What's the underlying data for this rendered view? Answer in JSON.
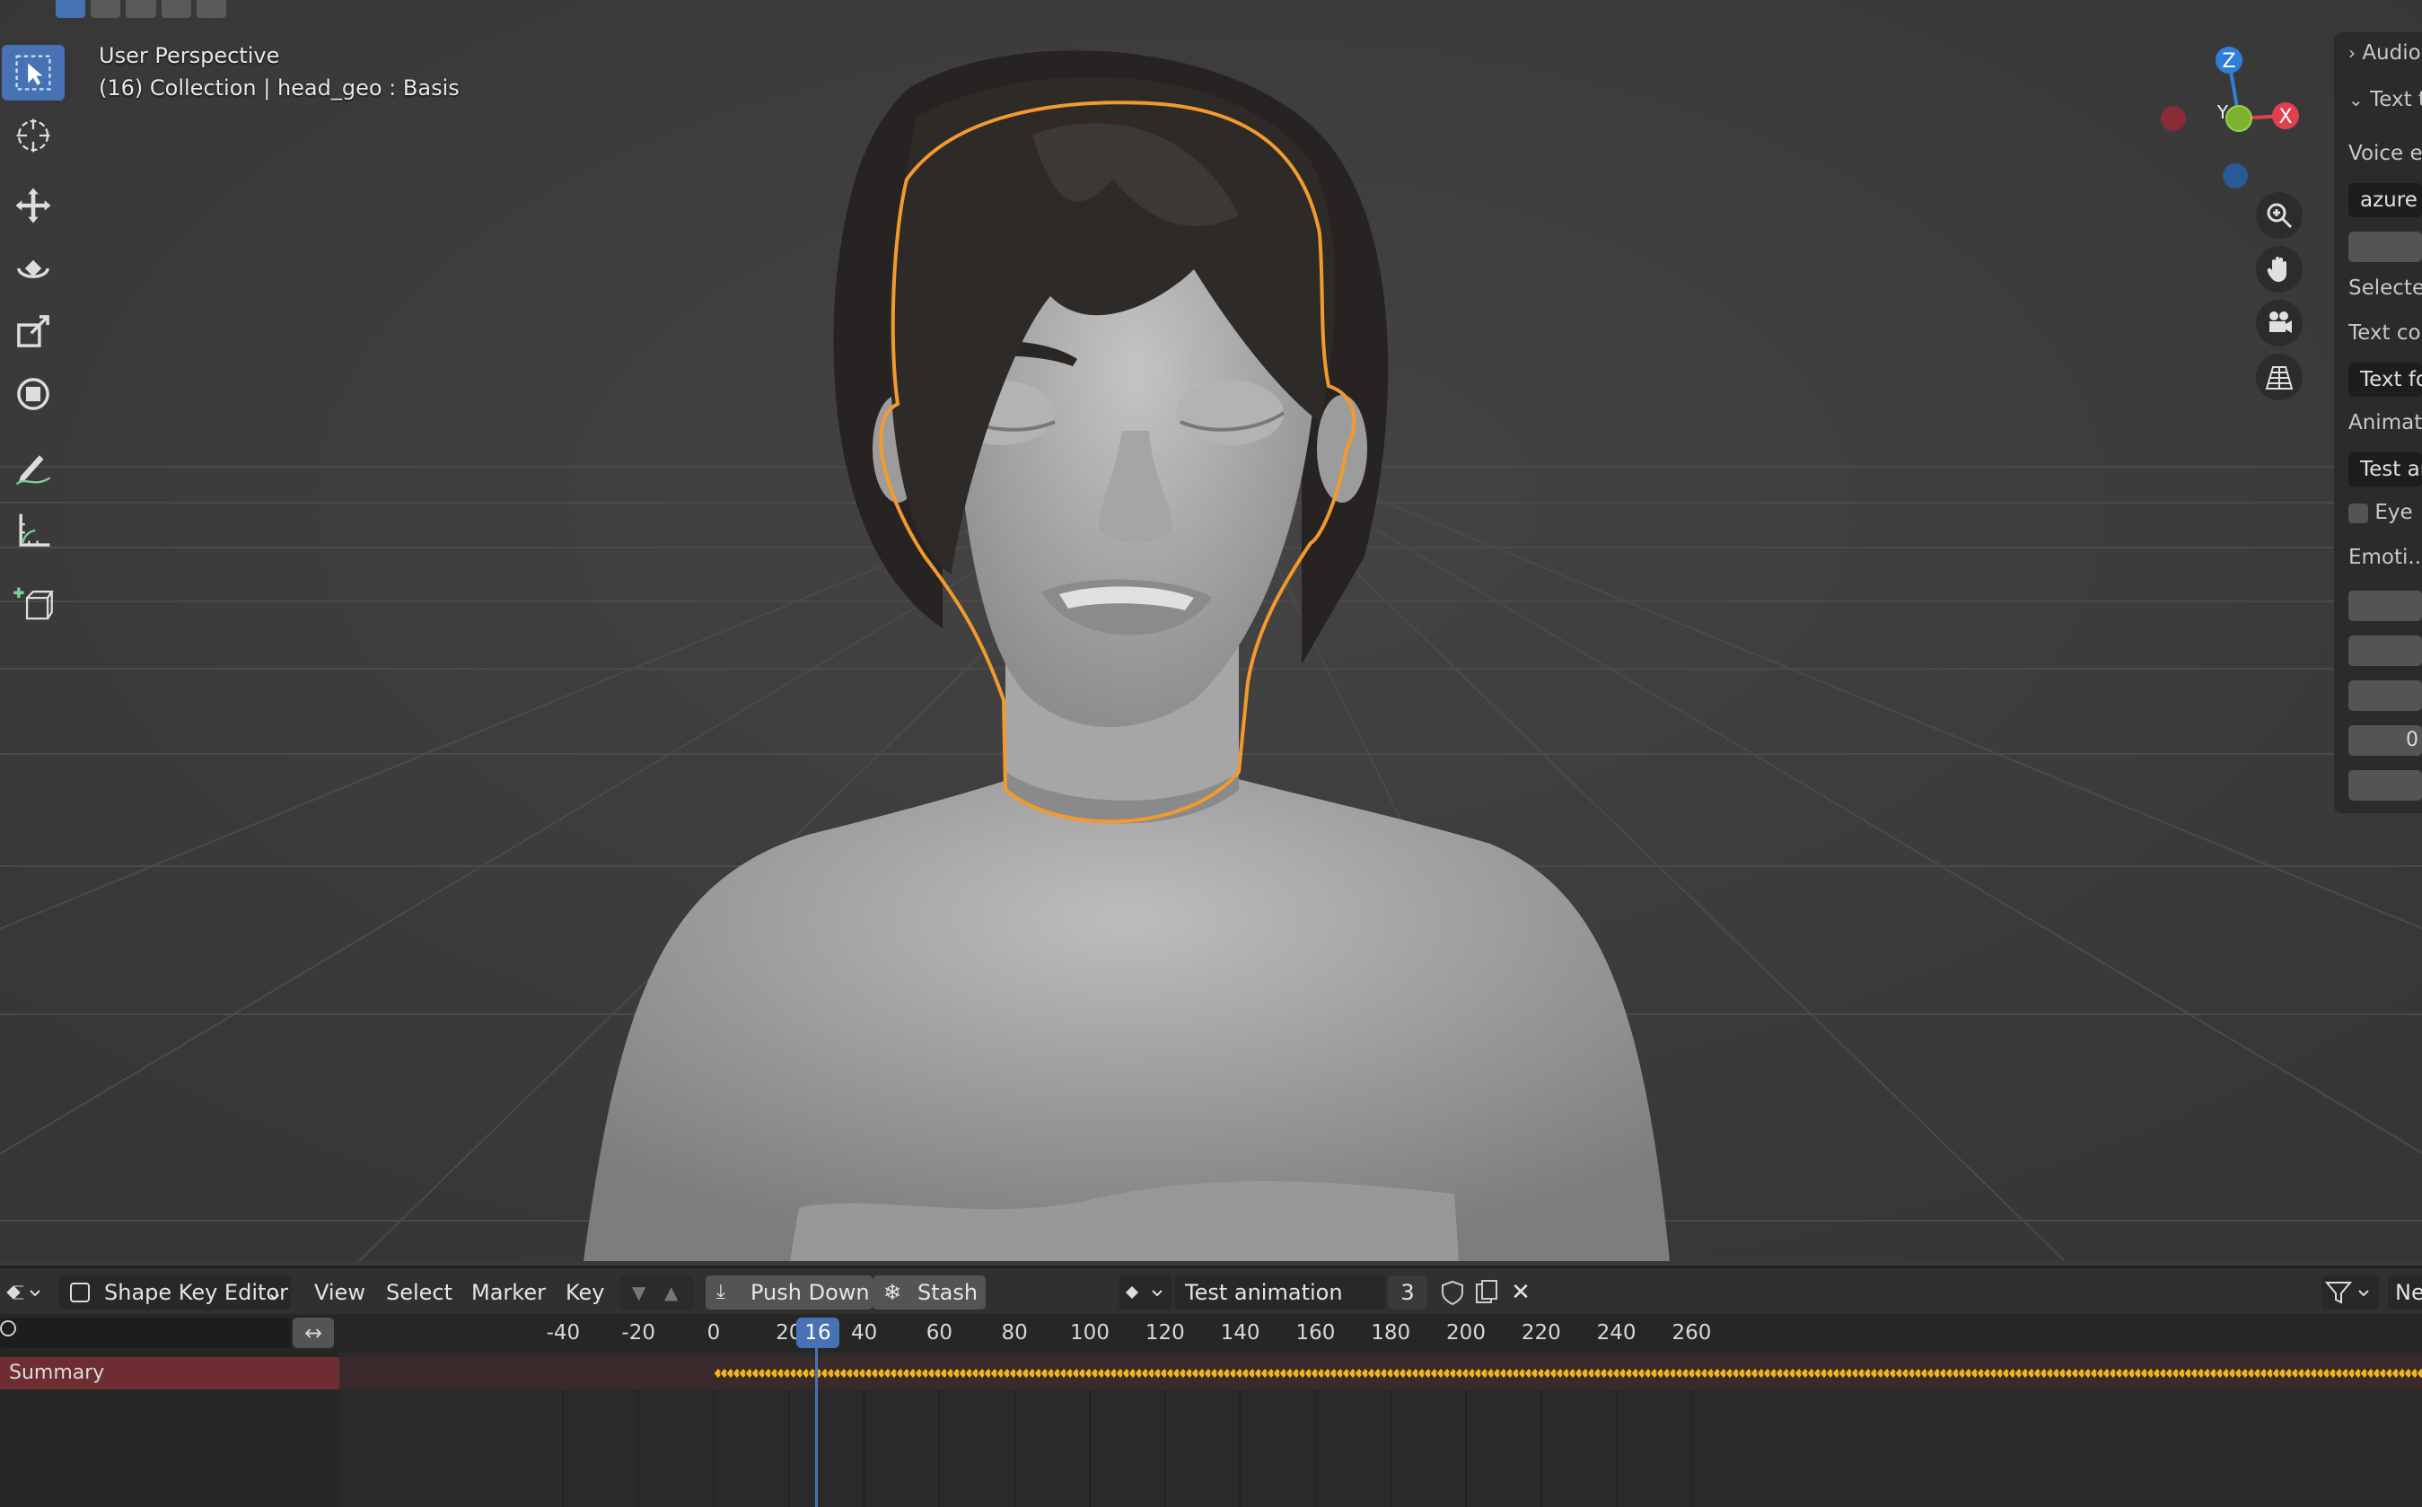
{
  "viewport": {
    "perspective_label": "User Perspective",
    "object_info": "(16) Collection | head_geo : Basis",
    "axes": {
      "z": "Z",
      "x": "X",
      "y": "Y",
      "z_color": "#2f7fd8",
      "x_color": "#e04050",
      "y_color": "#7bb32e"
    },
    "selection_outline_color": "#f29a2e"
  },
  "toolbar_icons": [
    "select-box-icon",
    "cursor-icon",
    "move-icon",
    "rotate-icon",
    "scale-icon",
    "transform-icon",
    "annotate-icon",
    "measure-icon",
    "add-cube-icon"
  ],
  "nav_icons": [
    "zoom-icon",
    "hand-pan-icon",
    "camera-icon",
    "grid-perspective-icon"
  ],
  "npanel": {
    "audio_section": "Audio",
    "text_section": "Text t",
    "voice_label": "Voice e",
    "voice_value": "azure",
    "selected_label": "Selecte",
    "text_con_label": "Text con",
    "text_fo_value": "Text fo",
    "animati_label": "Animati",
    "test_an_value": "Test an",
    "eye_label": "Eye",
    "emoti_label": "Emoti...",
    "zero_label": "0"
  },
  "editor": {
    "mode_label": "Shape Key Editor",
    "menus": [
      "View",
      "Select",
      "Marker",
      "Key"
    ],
    "push_down": "Push Down",
    "stash": "Stash",
    "action_name": "Test animation",
    "action_users": "3",
    "right_partial": "Ne",
    "current_frame": "16",
    "ruler_ticks": [
      "-40",
      "-20",
      "0",
      "20",
      "40",
      "60",
      "80",
      "100",
      "120",
      "140",
      "160",
      "180",
      "200",
      "220",
      "240",
      "260"
    ],
    "summary_label": "Summary",
    "accent_color": "#4772b3",
    "keyframe_color": "#f0b428"
  }
}
